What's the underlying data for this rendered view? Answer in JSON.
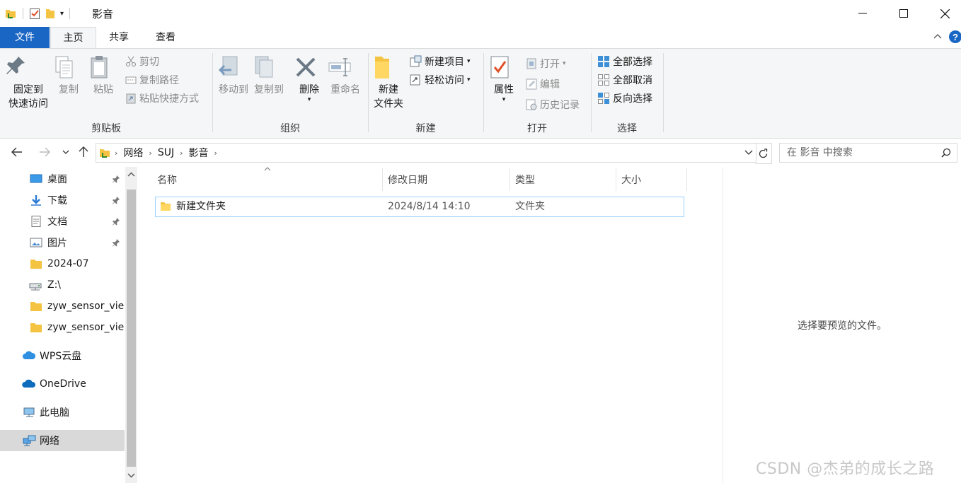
{
  "window": {
    "title": "影音"
  },
  "tabs": {
    "file": "文件",
    "home": "主页",
    "share": "共享",
    "view": "查看"
  },
  "ribbon": {
    "clipboard": {
      "label": "剪贴板",
      "pin_line1": "固定到",
      "pin_line2": "快速访问",
      "copy": "复制",
      "paste": "粘贴",
      "cut": "剪切",
      "copy_path": "复制路径",
      "paste_shortcut": "粘贴快捷方式"
    },
    "organize": {
      "label": "组织",
      "move_to": "移动到",
      "copy_to": "复制到",
      "delete": "删除",
      "rename": "重命名"
    },
    "new": {
      "label": "新建",
      "new_folder_line1": "新建",
      "new_folder_line2": "文件夹",
      "new_item": "新建项目",
      "easy_access": "轻松访问"
    },
    "open": {
      "label": "打开",
      "properties": "属性",
      "open": "打开",
      "edit": "编辑",
      "history": "历史记录"
    },
    "select": {
      "label": "选择",
      "select_all": "全部选择",
      "select_none": "全部取消",
      "invert": "反向选择"
    }
  },
  "address": {
    "crumbs": [
      "网络",
      "SUJ",
      "影音"
    ]
  },
  "search": {
    "placeholder": "在 影音 中搜索"
  },
  "nav": {
    "items": [
      {
        "label": "桌面",
        "pinned": true
      },
      {
        "label": "下载",
        "pinned": true
      },
      {
        "label": "文档",
        "pinned": true
      },
      {
        "label": "图片",
        "pinned": true
      },
      {
        "label": "2024-07"
      },
      {
        "label": "Z:\\"
      },
      {
        "label": "zyw_sensor_vie"
      },
      {
        "label": "zyw_sensor_vie"
      },
      {
        "label": "WPS云盘"
      },
      {
        "label": "OneDrive"
      },
      {
        "label": "此电脑"
      },
      {
        "label": "网络",
        "selected": true
      }
    ]
  },
  "columns": {
    "name": "名称",
    "date": "修改日期",
    "type": "类型",
    "size": "大小"
  },
  "files": [
    {
      "name": "新建文件夹",
      "date": "2024/8/14 14:10",
      "type": "文件夹",
      "size": ""
    }
  ],
  "preview": {
    "message": "选择要预览的文件。"
  },
  "watermark": "CSDN @杰弟的成长之路",
  "colors": {
    "accent": "#1a66c4",
    "folder": "#f5c342",
    "selection_border": "#99d1ff"
  }
}
